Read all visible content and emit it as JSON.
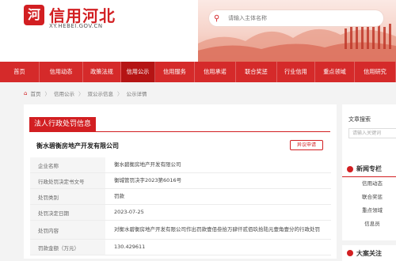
{
  "header": {
    "logo_text": "河",
    "site_name": "信用河北",
    "site_url": "XY.HEBEI.GOV.CN",
    "search_placeholder": "请输入主体名称"
  },
  "nav": {
    "items": [
      {
        "label": "首页",
        "active": false
      },
      {
        "label": "信用动态",
        "active": false
      },
      {
        "label": "政策法规",
        "active": false
      },
      {
        "label": "信用公示",
        "active": true
      },
      {
        "label": "信用服务",
        "active": false
      },
      {
        "label": "信用承诺",
        "active": false
      },
      {
        "label": "联合奖惩",
        "active": false
      },
      {
        "label": "行业信用",
        "active": false
      },
      {
        "label": "重点领域",
        "active": false
      },
      {
        "label": "信用研究",
        "active": false
      }
    ]
  },
  "breadcrumb": [
    "首页",
    "信用公示",
    "双公示信息",
    "公示详情"
  ],
  "main": {
    "title": "法人行政处罚信息",
    "company": "衡水碧衡房地产开发有限公司",
    "objection_label": "异议申请",
    "rows": [
      {
        "key": "企业名称",
        "value": "衡水碧衡房地产开发有限公司"
      },
      {
        "key": "行政处罚决定书文号",
        "value": "衡城管罚决字2023第6016号"
      },
      {
        "key": "处罚类别",
        "value": "罚款"
      },
      {
        "key": "处罚决定日期",
        "value": "2023-07-25"
      },
      {
        "key": "处罚内容",
        "value": "对衡水碧衡房地产开发有限公司作出罚款壹佰叁拾万肆仟贰佰玖拾陆元壹角壹分的行政处罚"
      },
      {
        "key": "罚款金额（万元）",
        "value": "130.429611"
      }
    ]
  },
  "side": {
    "search_title": "文章搜索",
    "search_placeholder": "请输入关键词",
    "news_title": "新闻专栏",
    "news_links": [
      "信用动态",
      "联合奖惩",
      "重点领域",
      "信息员"
    ],
    "cases_title": "大案关注"
  },
  "colors": {
    "brand_red": "#d21f22",
    "nav_red": "#d52a2a",
    "nav_active": "#b51414"
  }
}
